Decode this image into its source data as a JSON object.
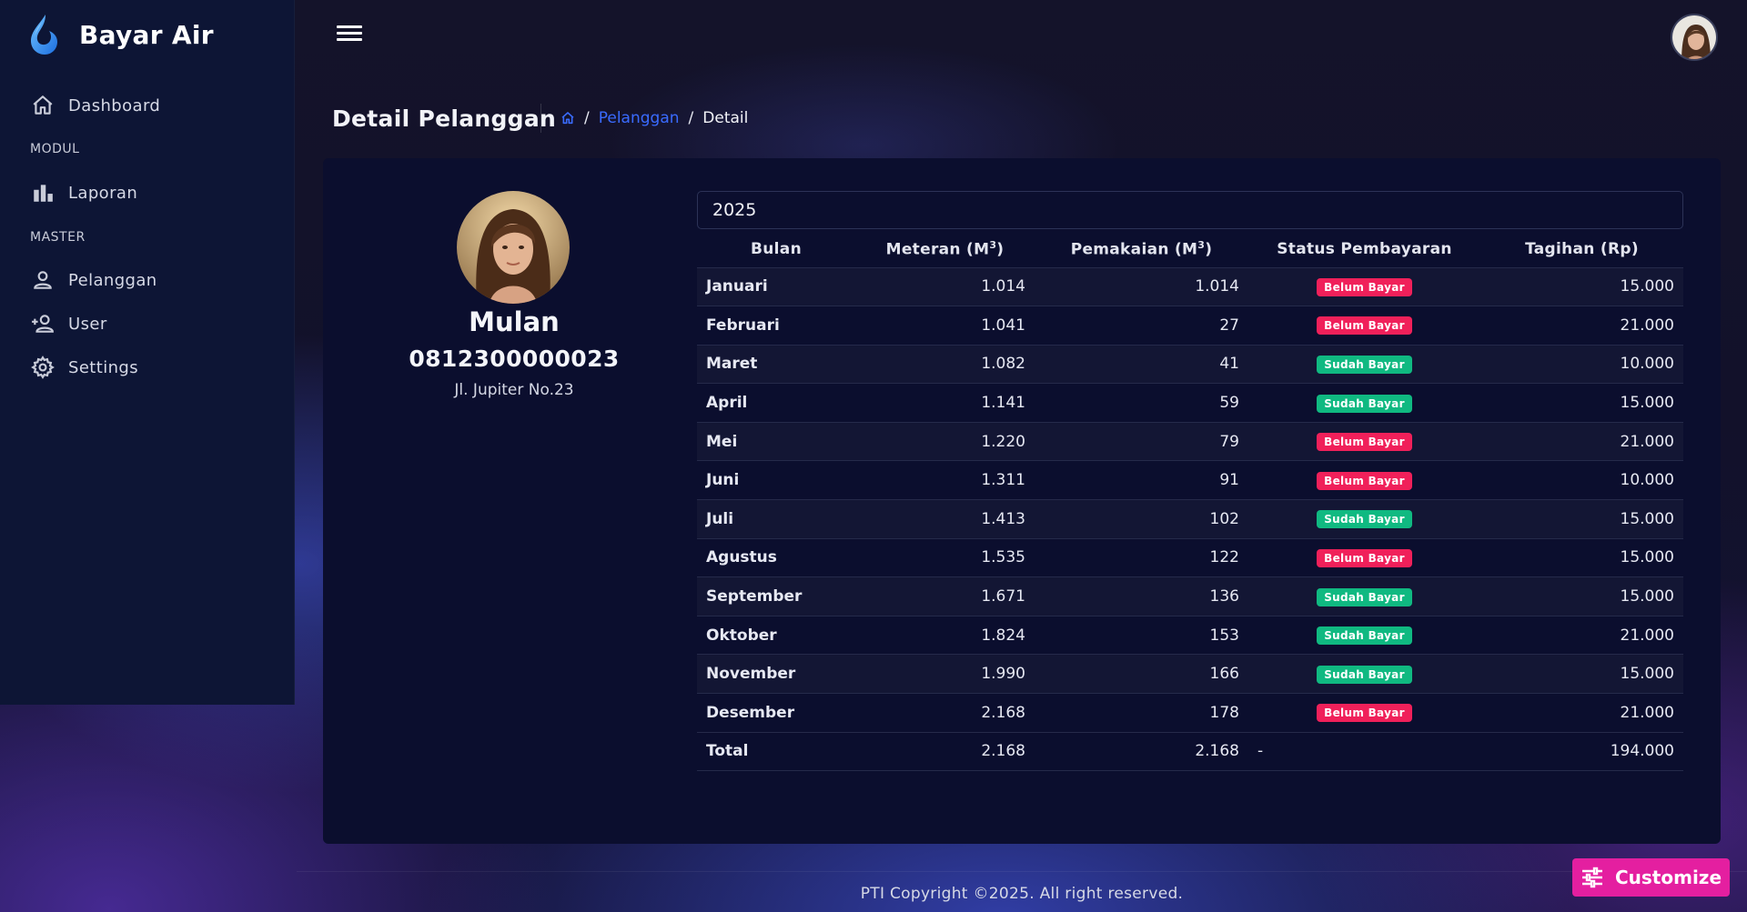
{
  "app": {
    "name": "Bayar Air"
  },
  "sidebar": {
    "items": [
      {
        "label": "Dashboard",
        "icon": "home-icon"
      },
      {
        "label": "Laporan",
        "icon": "bar-chart-icon"
      },
      {
        "label": "Pelanggan",
        "icon": "person-icon"
      },
      {
        "label": "User",
        "icon": "person-add-icon"
      },
      {
        "label": "Settings",
        "icon": "gear-icon"
      }
    ],
    "sections": {
      "modul": "MODUL",
      "master": "MASTER"
    }
  },
  "page": {
    "title": "Detail Pelanggan",
    "breadcrumb": {
      "sep": "/",
      "parent": "Pelanggan",
      "current": "Detail"
    }
  },
  "customer": {
    "name": "Mulan",
    "phone": "0812300000023",
    "address": "Jl. Jupiter No.23"
  },
  "year_select": {
    "value": "2025"
  },
  "table": {
    "headers": {
      "month": "Bulan",
      "meter": "Meteran (M",
      "usage": "Pemakaian (M",
      "unit_sup": "3",
      "unit_close": ")",
      "status": "Status Pembayaran",
      "bill": "Tagihan (Rp)"
    },
    "rows": [
      {
        "month": "Januari",
        "meter": "1.014",
        "usage": "1.014",
        "status": "Belum Bayar",
        "paid": false,
        "bill": "15.000"
      },
      {
        "month": "Februari",
        "meter": "1.041",
        "usage": "27",
        "status": "Belum Bayar",
        "paid": false,
        "bill": "21.000"
      },
      {
        "month": "Maret",
        "meter": "1.082",
        "usage": "41",
        "status": "Sudah Bayar",
        "paid": true,
        "bill": "10.000"
      },
      {
        "month": "April",
        "meter": "1.141",
        "usage": "59",
        "status": "Sudah Bayar",
        "paid": true,
        "bill": "15.000"
      },
      {
        "month": "Mei",
        "meter": "1.220",
        "usage": "79",
        "status": "Belum Bayar",
        "paid": false,
        "bill": "21.000"
      },
      {
        "month": "Juni",
        "meter": "1.311",
        "usage": "91",
        "status": "Belum Bayar",
        "paid": false,
        "bill": "10.000"
      },
      {
        "month": "Juli",
        "meter": "1.413",
        "usage": "102",
        "status": "Sudah Bayar",
        "paid": true,
        "bill": "15.000"
      },
      {
        "month": "Agustus",
        "meter": "1.535",
        "usage": "122",
        "status": "Belum Bayar",
        "paid": false,
        "bill": "15.000"
      },
      {
        "month": "September",
        "meter": "1.671",
        "usage": "136",
        "status": "Sudah Bayar",
        "paid": true,
        "bill": "15.000"
      },
      {
        "month": "Oktober",
        "meter": "1.824",
        "usage": "153",
        "status": "Sudah Bayar",
        "paid": true,
        "bill": "21.000"
      },
      {
        "month": "November",
        "meter": "1.990",
        "usage": "166",
        "status": "Sudah Bayar",
        "paid": true,
        "bill": "15.000"
      },
      {
        "month": "Desember",
        "meter": "2.168",
        "usage": "178",
        "status": "Belum Bayar",
        "paid": false,
        "bill": "21.000"
      }
    ],
    "total": {
      "label": "Total",
      "meter": "2.168",
      "usage": "2.168",
      "status": "-",
      "bill": "194.000"
    }
  },
  "footer": {
    "text": "PTI Copyright ©2025. All right reserved."
  },
  "customize": {
    "label": "Customize"
  },
  "colors": {
    "accent": "#3a6bff",
    "sidebar": "#0d1535",
    "card": "#0b0e2e",
    "badge_unpaid": "#f0205a",
    "badge_paid": "#10b981",
    "customize": "#e41fa0"
  }
}
